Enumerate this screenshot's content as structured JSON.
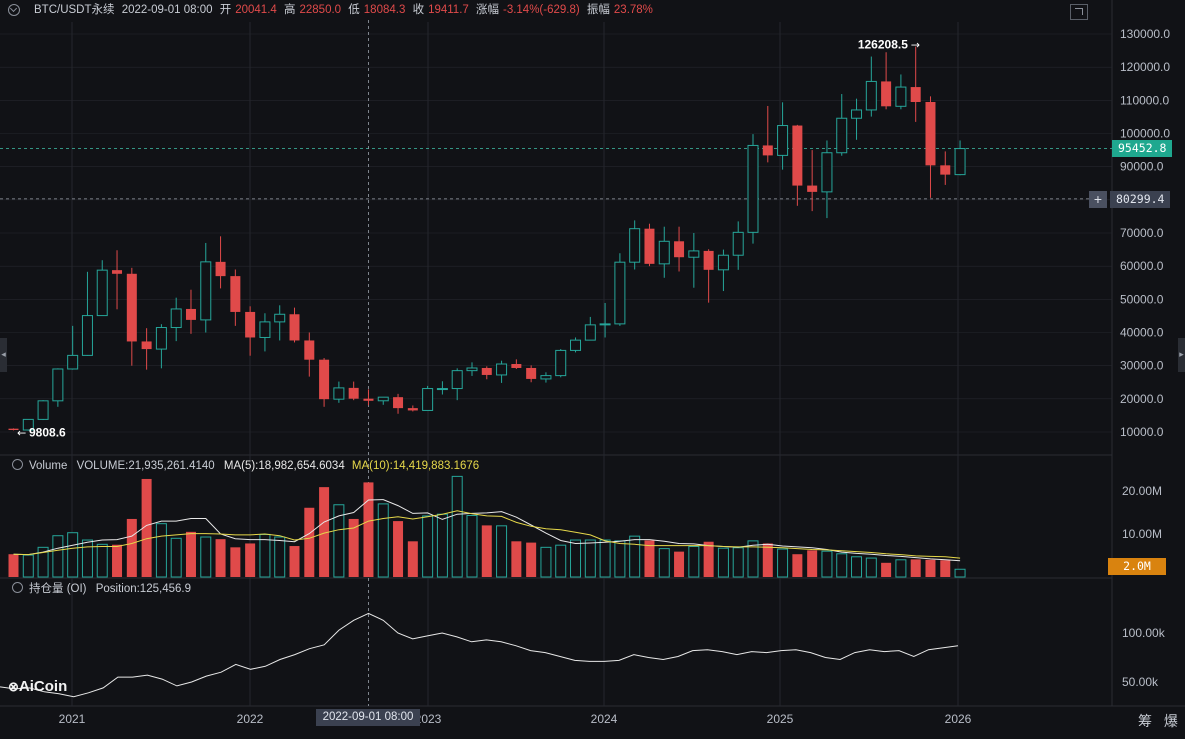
{
  "header": {
    "symbol": "BTC/USDT永续",
    "datetime": "2022-09-01 08:00",
    "open_label": "开",
    "open_value": "20041.4",
    "high_label": "高",
    "high_value": "22850.0",
    "low_label": "低",
    "low_value": "18084.3",
    "close_label": "收",
    "close_value": "19411.7",
    "change_label": "涨幅",
    "change_value": "-3.14%(-629.8)",
    "amp_label": "振幅",
    "amp_value": "23.78%"
  },
  "colors": {
    "up": "#26a69a",
    "down": "#e04a4a",
    "bg": "#111216",
    "grid": "#25272d",
    "ma5": "#e8e8e8",
    "ma10": "#e6d84a",
    "volume_badge": "#d9830f",
    "price_badge": "#1fa88f"
  },
  "price_axis": {
    "ticks": [
      "130000.0",
      "120000.0",
      "110000.0",
      "100000.0",
      "90000.0",
      "80000.0",
      "70000.0",
      "60000.0",
      "50000.0",
      "40000.0",
      "30000.0",
      "20000.0",
      "10000.0"
    ]
  },
  "price_badges": {
    "current": "95452.8",
    "cursor": "80299.4"
  },
  "annotations": {
    "max_label": "126208.5",
    "min_label": "9808.6"
  },
  "volume_panel": {
    "label": "Volume",
    "volume": "VOLUME:21,935,261.4140",
    "ma5": "MA(5):18,982,654.6034",
    "ma10": "MA(10):14,419,883.1676",
    "ticks": [
      "20.00M",
      "10.00M"
    ],
    "badge": "2.0M"
  },
  "oi_panel": {
    "label": "持仓量 (OI)",
    "position": "Position:125,456.9",
    "ticks": [
      "100.00k",
      "50.00k"
    ]
  },
  "time_axis": {
    "labels": [
      "2021",
      "2022",
      "2023",
      "2024",
      "2025",
      "2026"
    ],
    "cursor_label": "2022-09-01 08:00"
  },
  "logo": "AiCoin",
  "bottom_right": "筹 爆",
  "chart_data": {
    "type": "candlestick",
    "interval": "1M",
    "ylim": [
      0,
      135000
    ],
    "candles": [
      [
        11000,
        11100,
        10500,
        10600
      ],
      [
        10600,
        13900,
        10400,
        13800
      ],
      [
        13800,
        19600,
        13600,
        19400
      ],
      [
        19400,
        29200,
        17600,
        29000
      ],
      [
        29000,
        42000,
        28800,
        33100
      ],
      [
        33100,
        58300,
        33000,
        45100
      ],
      [
        45100,
        61800,
        45000,
        58800
      ],
      [
        58800,
        64800,
        47000,
        57700
      ],
      [
        57700,
        59500,
        30000,
        37300
      ],
      [
        37300,
        41300,
        28800,
        35000
      ],
      [
        35000,
        42500,
        29200,
        41500
      ],
      [
        41500,
        50500,
        37400,
        47100
      ],
      [
        47100,
        52900,
        39600,
        43800
      ],
      [
        43800,
        67000,
        40000,
        61300
      ],
      [
        61300,
        69000,
        53300,
        57000
      ],
      [
        57000,
        59000,
        42000,
        46200
      ],
      [
        46200,
        47900,
        33000,
        38500
      ],
      [
        38500,
        45800,
        34300,
        43200
      ],
      [
        43200,
        48200,
        37600,
        45500
      ],
      [
        45500,
        47500,
        37000,
        37600
      ],
      [
        37600,
        40000,
        26700,
        31800
      ],
      [
        31800,
        32300,
        17600,
        19900
      ],
      [
        19900,
        25200,
        18800,
        23300
      ],
      [
        23300,
        25200,
        19600,
        20050
      ],
      [
        20050,
        22850,
        18084,
        19412
      ],
      [
        19412,
        20500,
        18200,
        20500
      ],
      [
        20500,
        21500,
        15500,
        17200
      ],
      [
        17200,
        18000,
        16200,
        16500
      ],
      [
        16500,
        23900,
        16500,
        23100
      ],
      [
        23100,
        25300,
        21300,
        23100
      ],
      [
        23100,
        29200,
        19600,
        28500
      ],
      [
        28500,
        31000,
        26900,
        29300
      ],
      [
        29300,
        29800,
        25900,
        27200
      ],
      [
        27200,
        31500,
        24800,
        30500
      ],
      [
        30500,
        31900,
        29000,
        29300
      ],
      [
        29300,
        30100,
        25000,
        26000
      ],
      [
        26000,
        28000,
        24900,
        27000
      ],
      [
        27000,
        35000,
        26500,
        34600
      ],
      [
        34600,
        38500,
        34000,
        37700
      ],
      [
        37700,
        44700,
        37600,
        42300
      ],
      [
        42300,
        48900,
        38500,
        42600
      ],
      [
        42600,
        63900,
        42000,
        61200
      ],
      [
        61200,
        73800,
        59000,
        71300
      ],
      [
        71300,
        72800,
        60000,
        60700
      ],
      [
        60700,
        71900,
        56500,
        67500
      ],
      [
        67500,
        71900,
        58400,
        62700
      ],
      [
        62700,
        70000,
        53500,
        64600
      ],
      [
        64600,
        65100,
        49000,
        58900
      ],
      [
        58900,
        65000,
        52500,
        63300
      ],
      [
        63300,
        73500,
        58900,
        70200
      ],
      [
        70200,
        99800,
        66800,
        96400
      ],
      [
        96400,
        108300,
        91300,
        93400
      ],
      [
        93400,
        109400,
        89100,
        102400
      ],
      [
        102400,
        102600,
        78200,
        84300
      ],
      [
        84300,
        95000,
        76600,
        82400
      ],
      [
        82400,
        97900,
        74500,
        94200
      ],
      [
        94200,
        111900,
        93300,
        104600
      ],
      [
        104600,
        110500,
        98100,
        107100
      ],
      [
        107100,
        123200,
        105100,
        115700
      ],
      [
        115700,
        124500,
        107300,
        108200
      ],
      [
        108200,
        117800,
        107300,
        114000
      ],
      [
        114000,
        126200,
        103500,
        109500
      ],
      [
        109500,
        111200,
        80600,
        90400
      ],
      [
        90400,
        94600,
        84500,
        87600
      ],
      [
        87600,
        97900,
        87400,
        95453
      ]
    ],
    "volume_millions": [
      5.3,
      5.1,
      6.9,
      9.6,
      10.3,
      8.6,
      7.6,
      7.5,
      13.5,
      22.8,
      12.4,
      9.0,
      10.5,
      9.3,
      8.8,
      6.9,
      7.8,
      9.9,
      9.3,
      7.2,
      16.1,
      20.9,
      16.8,
      13.5,
      22.0,
      17.0,
      13.0,
      8.3,
      14.2,
      14.6,
      23.4,
      14.3,
      12.0,
      11.9,
      8.3,
      8.0,
      6.9,
      7.4,
      8.6,
      8.6,
      8.6,
      8.4,
      9.5,
      8.5,
      6.6,
      5.9,
      7.1,
      8.2,
      6.7,
      6.8,
      8.4,
      7.8,
      6.5,
      5.3,
      6.2,
      6.0,
      5.4,
      4.7,
      4.4,
      3.3,
      4.0,
      4.1,
      4.0,
      3.9,
      1.8
    ],
    "ma5_millions": [
      5.3,
      5.2,
      5.8,
      6.7,
      7.4,
      8.1,
      8.6,
      8.7,
      9.5,
      12.0,
      13.0,
      13.0,
      13.6,
      13.6,
      10.0,
      8.9,
      8.7,
      8.7,
      8.5,
      8.2,
      10.1,
      12.8,
      14.2,
      15.0,
      17.9,
      18.0,
      16.6,
      14.8,
      14.9,
      13.4,
      14.6,
      14.8,
      14.9,
      15.2,
      13.9,
      12.1,
      10.2,
      8.5,
      7.8,
      7.9,
      8.1,
      8.3,
      8.7,
      8.7,
      8.3,
      7.8,
      7.7,
      7.3,
      7.1,
      6.9,
      7.4,
      7.6,
      7.2,
      7.0,
      6.8,
      6.4,
      5.8,
      5.5,
      5.3,
      5.0,
      4.8,
      4.5,
      4.2,
      4.0,
      3.8
    ],
    "ma10_millions": [
      5.3,
      5.2,
      5.7,
      6.2,
      6.7,
      7.0,
      7.1,
      7.1,
      7.8,
      8.9,
      9.5,
      9.8,
      10.1,
      10.1,
      10.0,
      9.8,
      9.8,
      10.0,
      9.6,
      8.6,
      9.0,
      10.2,
      11.0,
      11.4,
      13.0,
      13.6,
      14.0,
      13.5,
      14.0,
      14.6,
      15.4,
      14.7,
      14.2,
      14.1,
      12.7,
      11.8,
      11.2,
      11.0,
      10.4,
      9.8,
      8.4,
      7.8,
      7.6,
      7.3,
      7.3,
      7.3,
      7.3,
      7.3,
      7.1,
      7.0,
      7.0,
      6.9,
      6.8,
      6.6,
      6.4,
      6.3,
      6.1,
      5.9,
      5.7,
      5.4,
      5.2,
      4.9,
      4.8,
      4.7,
      4.4
    ],
    "oi_thousands": [
      45,
      43,
      44,
      40,
      38,
      35,
      39,
      44,
      55,
      55,
      57,
      53,
      46,
      50,
      56,
      60,
      68,
      63,
      66,
      73,
      78,
      84,
      88,
      103,
      113,
      120,
      113,
      100,
      94,
      97,
      100,
      96,
      91,
      93,
      91,
      87,
      82,
      80,
      76,
      72,
      71,
      71,
      72,
      78,
      75,
      73,
      76,
      82,
      83,
      81,
      78,
      81,
      80,
      82,
      83,
      80,
      75,
      73,
      80,
      83,
      81,
      82,
      76,
      83,
      85,
      87
    ]
  }
}
